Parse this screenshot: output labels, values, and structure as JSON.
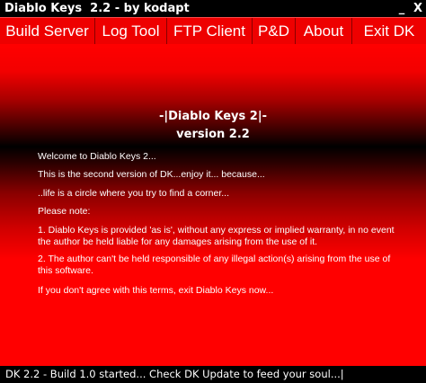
{
  "window": {
    "title": "Diablo Keys  2.2 - by kodapt",
    "minimize_glyph": "_",
    "close_glyph": "X"
  },
  "menu": {
    "items": [
      {
        "label": "Build Server"
      },
      {
        "label": "Log Tool"
      },
      {
        "label": "FTP Client"
      },
      {
        "label": "P&D"
      },
      {
        "label": "About"
      },
      {
        "label": "Exit DK"
      }
    ]
  },
  "content": {
    "heading": "-|Diablo Keys 2|-",
    "version": "version 2.2",
    "paragraphs": [
      "Welcome to Diablo Keys 2...",
      "This is the second version of DK...enjoy it... because...",
      "..life is a circle where you try to find a corner...",
      "Please note:",
      "1. Diablo Keys is provided 'as is', without any express or implied warranty, in no event the author be held liable for any damages arising from the use of it.",
      "2. The author can't be held responsible of any illegal action(s) arising from the use of this software.",
      "If you don't agree with this terms, exit Diablo Keys now..."
    ]
  },
  "status": {
    "text": "DK 2.2 - Build 1.0 started... Check DK Update to feed your soul...|"
  },
  "colors": {
    "menu_bg": "#ee0000",
    "content_red": "#ff0000",
    "frame_bg": "#000000",
    "text": "#ffffff"
  }
}
